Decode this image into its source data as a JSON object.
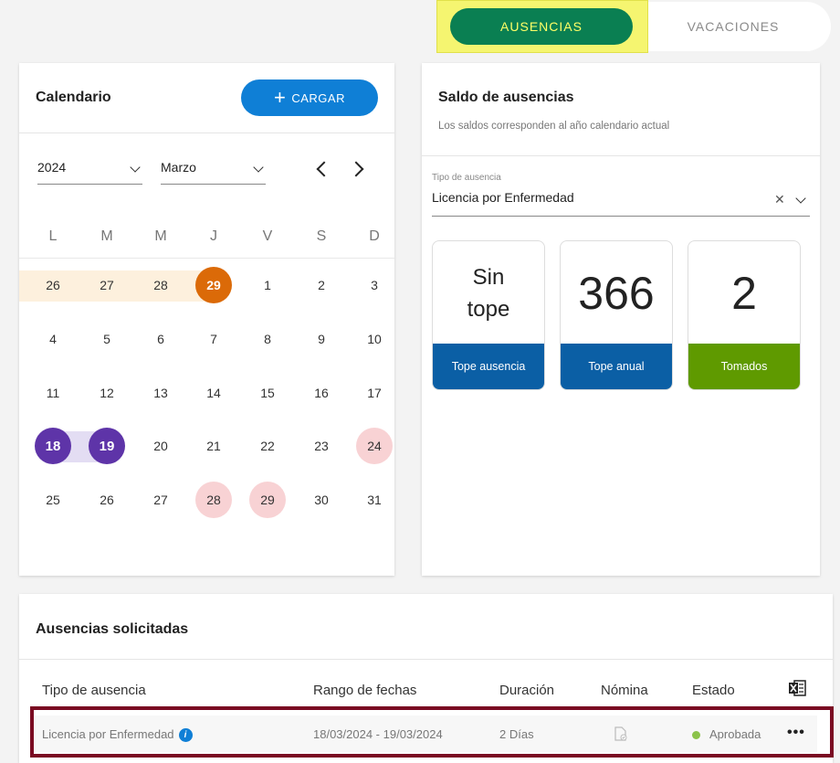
{
  "tabs": {
    "active": "AUSENCIAS",
    "inactive": "VACACIONES"
  },
  "calendar": {
    "title": "Calendario",
    "cargar_label": "CARGAR",
    "year": "2024",
    "month": "Marzo",
    "weekdays": [
      "L",
      "M",
      "M",
      "J",
      "V",
      "S",
      "D"
    ],
    "weeks": [
      [
        "26",
        "27",
        "28",
        "29",
        "1",
        "2",
        "3"
      ],
      [
        "4",
        "5",
        "6",
        "7",
        "8",
        "9",
        "10"
      ],
      [
        "11",
        "12",
        "13",
        "14",
        "15",
        "16",
        "17"
      ],
      [
        "18",
        "19",
        "20",
        "21",
        "22",
        "23",
        "24"
      ],
      [
        "25",
        "26",
        "27",
        "28",
        "29",
        "30",
        "31"
      ]
    ],
    "colors": {
      "today": "#db6a08",
      "selected_range": "#5e34a8",
      "holiday": "#f8d2d4",
      "prev_range": "#fdf0dd"
    }
  },
  "saldo": {
    "title": "Saldo de ausencias",
    "subtitle": "Los saldos corresponden al año calendario actual",
    "tipo_label": "Tipo de ausencia",
    "tipo_value": "Licencia por Enfermedad",
    "stats": [
      {
        "value": "Sin tope",
        "label": "Tope ausencia",
        "color": "#0b5fa5"
      },
      {
        "value": "366",
        "label": "Tope anual",
        "color": "#0b5fa5"
      },
      {
        "value": "2",
        "label": "Tomados",
        "color": "#5f9a00"
      }
    ]
  },
  "solicitadas": {
    "title": "Ausencias solicitadas",
    "headers": [
      "Tipo de ausencia",
      "Rango de fechas",
      "Duración",
      "Nómina",
      "Estado"
    ],
    "rows": [
      {
        "tipo": "Licencia por Enfermedad",
        "rango": "18/03/2024 - 19/03/2024",
        "duracion": "2 Días",
        "estado": "Aprobada"
      }
    ]
  }
}
